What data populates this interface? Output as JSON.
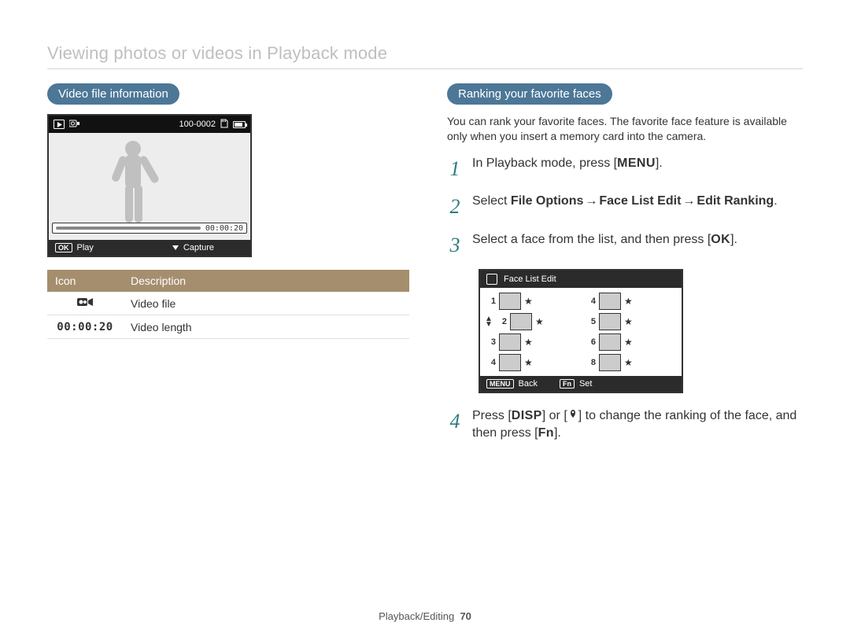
{
  "page_title": "Viewing photos or videos in Playback mode",
  "left": {
    "heading": "Video file information",
    "screenshot": {
      "folder_file": "100-0002",
      "elapsed": "00:00:20",
      "bottom": {
        "play": "Play",
        "capture": "Capture",
        "ok": "OK"
      }
    },
    "table": {
      "h1": "Icon",
      "h2": "Description",
      "r1_desc": "Video file",
      "r2_icon": "00:00:20",
      "r2_desc": "Video length"
    }
  },
  "right": {
    "heading": "Ranking your favorite faces",
    "intro": "You can rank your favorite faces. The favorite face feature is available only when you insert a memory card into the camera.",
    "step1": {
      "n": "1",
      "pre": "In Playback mode, press [",
      "kbd": "MENU",
      "post": "]."
    },
    "step2": {
      "n": "2",
      "pre": "Select ",
      "b1": "File Options",
      "arr": "→",
      "b2": "Face List Edit",
      "b3": "Edit Ranking",
      "post": "."
    },
    "step3": {
      "n": "3",
      "pre": "Select a face from the list, and then press [",
      "kbd": "OK",
      "post": "]."
    },
    "step4": {
      "n": "4",
      "pre": "Press [",
      "kbd1": "DISP",
      "mid": "] or [",
      "kbd2_tip": "macro-icon",
      "post": "] to change the ranking of the face, and then press [",
      "kbd3": "Fn",
      "tail": "]."
    },
    "facelist": {
      "title": "Face List Edit",
      "ranks": [
        "1",
        "2",
        "3",
        "4",
        "4",
        "5",
        "6",
        "8"
      ],
      "foot": {
        "menu": "MENU",
        "back": "Back",
        "fn": "Fn",
        "set": "Set"
      }
    }
  },
  "footer": {
    "section": "Playback/Editing",
    "page": "70"
  }
}
